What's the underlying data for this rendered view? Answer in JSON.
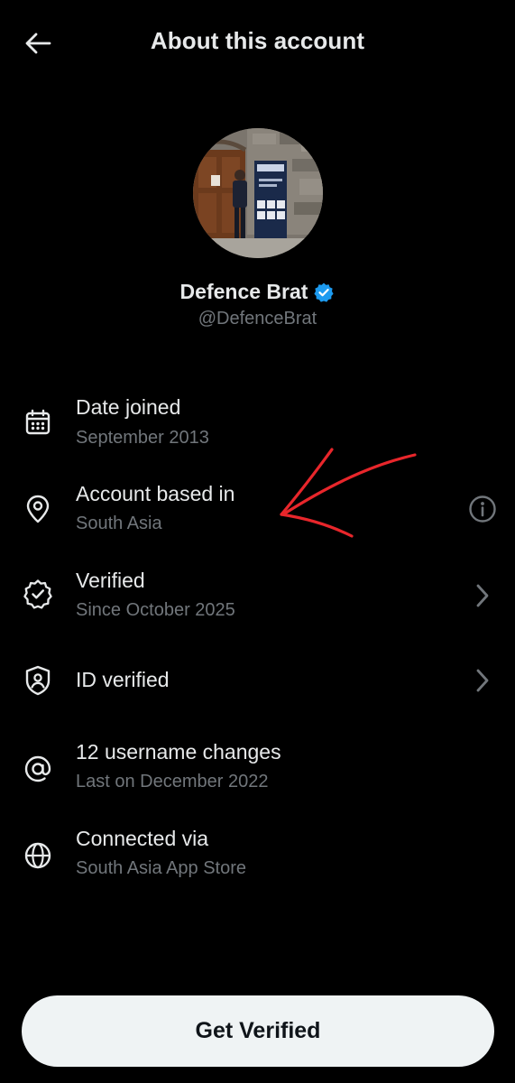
{
  "header": {
    "title": "About this account"
  },
  "profile": {
    "display_name": "Defence Brat",
    "handle": "@DefenceBrat",
    "verified_color": "#1d9bf0"
  },
  "rows": [
    {
      "icon": "calendar-icon",
      "title": "Date joined",
      "subtitle": "September 2013"
    },
    {
      "icon": "location-pin-icon",
      "title": "Account based in",
      "subtitle": "South Asia",
      "trailing": "info-icon"
    },
    {
      "icon": "verified-badge-icon",
      "title": "Verified",
      "subtitle": "Since October 2025",
      "trailing": "chevron-right-icon"
    },
    {
      "icon": "id-shield-icon",
      "title": "ID verified",
      "trailing": "chevron-right-icon"
    },
    {
      "icon": "at-sign-icon",
      "title": "12 username changes",
      "subtitle": "Last on December 2022"
    },
    {
      "icon": "globe-icon",
      "title": "Connected via",
      "subtitle": "South Asia App Store"
    }
  ],
  "cta": {
    "label": "Get Verified"
  },
  "colors": {
    "background": "#000000",
    "primary_text": "#e7e9ea",
    "secondary_text": "#71767b",
    "annotation": "#e8262b"
  }
}
